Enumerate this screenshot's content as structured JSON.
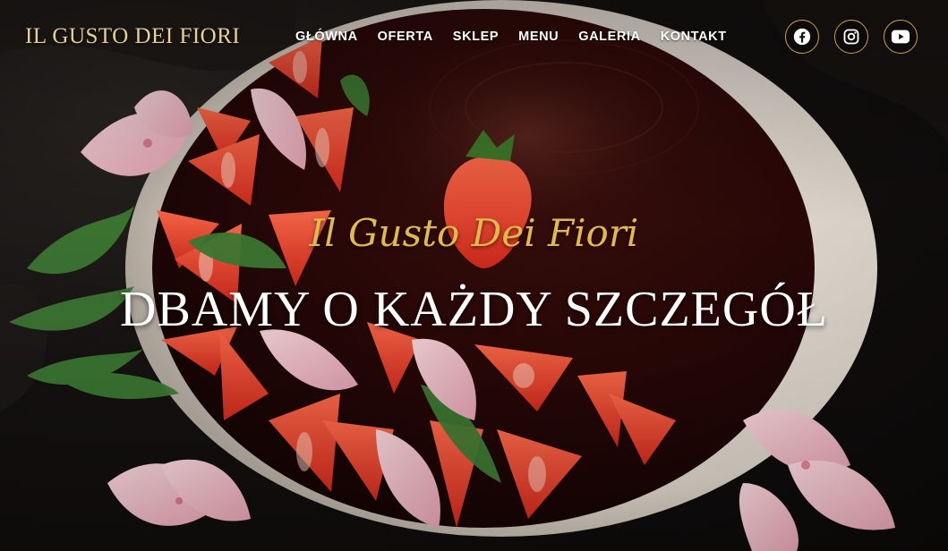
{
  "header": {
    "logo": "IL GUSTO DEI FIORI",
    "nav": [
      {
        "label": "GŁÓWNA"
      },
      {
        "label": "OFERTA"
      },
      {
        "label": "SKLEP"
      },
      {
        "label": "MENU"
      },
      {
        "label": "GALERIA"
      },
      {
        "label": "KONTAKT"
      }
    ],
    "social": [
      {
        "icon": "facebook-icon"
      },
      {
        "icon": "instagram-icon"
      },
      {
        "icon": "youtube-icon"
      }
    ]
  },
  "hero": {
    "tagline": "Il Gusto Dei Fiori",
    "headline": "DBAMY O KAŻDY SZCZEGÓŁ",
    "image": "chocolate-cake-with-strawberries-and-flowers"
  },
  "colors": {
    "logo": "#e8cf9a",
    "accent_gold": "#c9a045",
    "tagline": "#e2b94b",
    "nav_text": "#ffffff"
  }
}
